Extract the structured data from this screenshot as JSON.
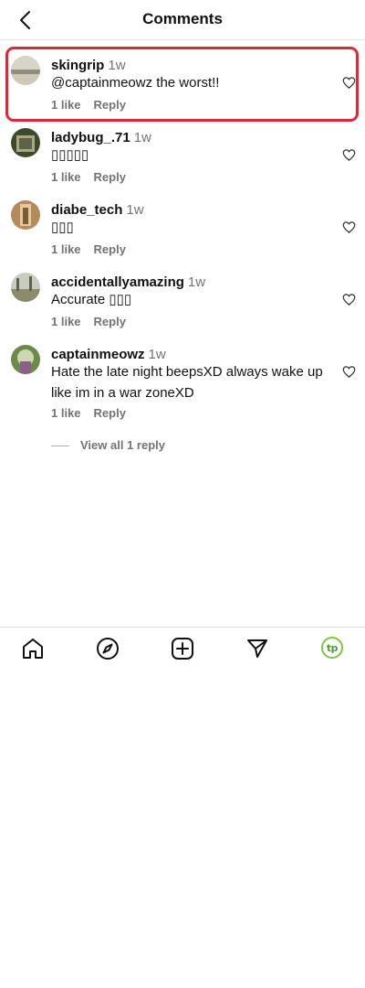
{
  "header": {
    "title": "Comments",
    "back_icon": "chevron-left-icon"
  },
  "comments": [
    {
      "username": "skingrip",
      "time": "1w",
      "text": "@captainmeowz the worst!!",
      "likes": "1 like",
      "reply": "Reply",
      "highlighted": true
    },
    {
      "username": "ladybug_.71",
      "time": "1w",
      "text": "▯▯▯▯▯",
      "likes": "1 like",
      "reply": "Reply"
    },
    {
      "username": "diabe_tech",
      "time": "1w",
      "text": "▯▯▯",
      "likes": "1 like",
      "reply": "Reply"
    },
    {
      "username": "accidentallyamazing",
      "time": "1w",
      "text": "Accurate ▯▯▯",
      "likes": "1 like",
      "reply": "Reply"
    },
    {
      "username": "captainmeowz",
      "time": "1w",
      "text": "Hate the late night beepsXD always wake up like im in a war zoneXD",
      "likes": "1 like",
      "reply": "Reply",
      "view_replies": "View all 1 reply"
    }
  ],
  "bottom_nav": {
    "items": [
      "home-icon",
      "explore-compass-icon",
      "new-post-icon",
      "direct-message-icon",
      "profile-avatar"
    ],
    "profile_initials": "tp"
  },
  "colors": {
    "highlight_border": "#e0263b",
    "secondary_text": "#737373",
    "profile_ring": "#7ac943"
  }
}
